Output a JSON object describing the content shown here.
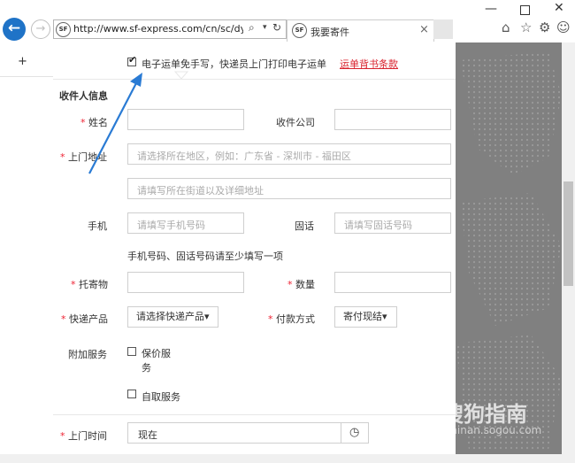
{
  "browser": {
    "url": "http://www.sf-express.com/cn/sc/dynami",
    "address_logo": "SF",
    "tab_title": "我要寄件",
    "tab_logo": "SF",
    "tab_close": "×",
    "back": "←",
    "forward": "→",
    "search_glyph": "⌕",
    "dropdown_glyph": "▾",
    "refresh_glyph": "↻",
    "minimize": "—",
    "close": "✕",
    "toolbar_icons": [
      "home-icon",
      "star-icon",
      "gear-icon",
      "smiley-icon"
    ],
    "home": "⌂",
    "star": "☆",
    "gear": "⚙",
    "smiley": "☺"
  },
  "left_panel": {
    "plus": "+"
  },
  "form": {
    "e_waybill_label": "电子运单免手写，快递员上门打印电子运单",
    "waybill_terms_link": "运单背书条款",
    "section_title": "收件人信息",
    "name_label": "姓名",
    "company_label": "收件公司",
    "address_label": "上门地址",
    "region_placeholder": "请选择所在地区，例如：广东省 - 深圳市 - 福田区",
    "street_placeholder": "请填写所在街道以及详细地址",
    "mobile_label": "手机",
    "mobile_placeholder": "请填写手机号码",
    "phone_label": "固话",
    "phone_placeholder": "请填写固话号码",
    "phone_hint": "手机号码、固话号码请至少填写一项",
    "item_label": "托寄物",
    "qty_label": "数量",
    "product_label": "快递产品",
    "product_select": "请选择快递产品",
    "payment_label": "付款方式",
    "payment_select": "寄付现结",
    "extra_label": "附加服务",
    "insured_line1": "保价服",
    "insured_line2": "务",
    "self_pickup": "自取服务",
    "pickup_time_label": "上门时间",
    "pickup_time_value": "现在",
    "required_mark": "*",
    "checkmark": "✔",
    "caret": "▾",
    "clock": "◷"
  },
  "watermark": {
    "text": "搜狗指南",
    "url": "zhinan.sogou.com"
  },
  "colors": {
    "accent_red": "#d9232e",
    "back_button": "#1f73c7",
    "annotation_arrow": "#2a7bd4"
  }
}
